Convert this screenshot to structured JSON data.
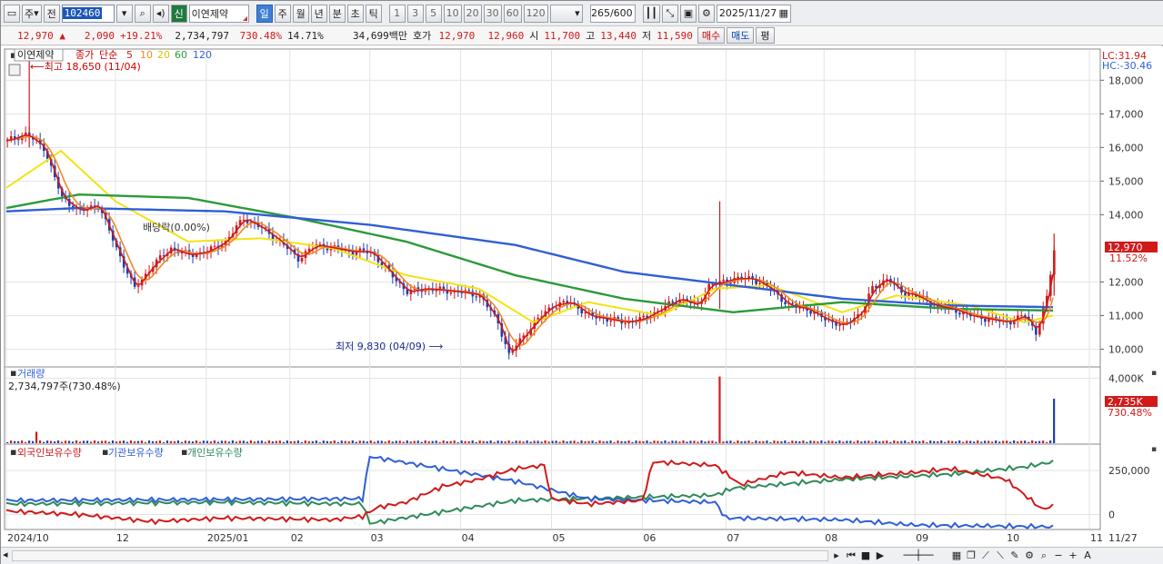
{
  "toolbar": {
    "period": "주",
    "prev_label": "전",
    "stock_code": "102460",
    "shin_label": "신",
    "stock_name": "이연제약",
    "tabs": [
      "일",
      "주",
      "월",
      "년",
      "분",
      "초",
      "틱"
    ],
    "active_tab": 0,
    "minute_options": [
      "1",
      "3",
      "5",
      "10",
      "20",
      "30",
      "60",
      "120"
    ],
    "bar_count": "265",
    "bar_max": "/600",
    "date": "2025/11/27"
  },
  "quote": {
    "price": "12,970",
    "arrow": "▲",
    "change": "2,090",
    "change_pct": "+19.21%",
    "volume": "2,734,797",
    "volume_ratio": "730.48%",
    "turnover": "14.71%",
    "amount": "34,699백만",
    "bid_label": "호가",
    "ask_price": "12,970",
    "bid_price": "12,960",
    "open_label": "시",
    "open": "11,700",
    "high_label": "고",
    "high": "13,440",
    "low_label": "저",
    "low": "11,590",
    "buy_label": "매수",
    "sell_label": "매도",
    "avg_label": "평"
  },
  "colors": {
    "up": "#d11a1a",
    "down": "#1f3fb0",
    "ma5": "#d11a1a",
    "ma10": "#f08a24",
    "ma20": "#f2e312",
    "ma60": "#2b9a3a",
    "ma120": "#2f5fd6",
    "foreign": "#d11a1a",
    "institution": "#2f5fd6",
    "individual": "#2e8b57"
  },
  "chart_data": [
    {
      "type": "candlestick",
      "legend": {
        "name": "이연제약",
        "price_label": "종가",
        "ma_label": "단순",
        "ma_periods": [
          "5",
          "10",
          "20",
          "60",
          "120"
        ]
      },
      "y_ticks": [
        "18,000",
        "17,000",
        "16,000",
        "15,000",
        "14,000",
        "12,000",
        "11,000",
        "10,000"
      ],
      "ylim": [
        9500,
        18900
      ],
      "right_labels": {
        "lc": "LC:31.94",
        "hc": "HC:-30.46",
        "current_price": "12,970",
        "current_pct": "11.52%"
      },
      "annotations": {
        "high": "최고 18,650 (11/04)",
        "low": "최저 9,830 (04/09)",
        "dividend": "배당락(0.00%)"
      },
      "price_path": [
        [
          0,
          16200
        ],
        [
          5,
          16400
        ],
        [
          10,
          16000
        ],
        [
          15,
          14500
        ],
        [
          20,
          14100
        ],
        [
          25,
          14300
        ],
        [
          30,
          13000
        ],
        [
          35,
          11800
        ],
        [
          40,
          12500
        ],
        [
          45,
          13000
        ],
        [
          50,
          12800
        ],
        [
          55,
          12900
        ],
        [
          60,
          13200
        ],
        [
          65,
          13900
        ],
        [
          70,
          13600
        ],
        [
          75,
          13200
        ],
        [
          80,
          12700
        ],
        [
          85,
          13100
        ],
        [
          90,
          13000
        ],
        [
          95,
          12900
        ],
        [
          100,
          12900
        ],
        [
          105,
          12300
        ],
        [
          110,
          11700
        ],
        [
          115,
          11800
        ],
        [
          120,
          11750
        ],
        [
          125,
          11700
        ],
        [
          130,
          11600
        ],
        [
          135,
          10800
        ],
        [
          138,
          9830
        ],
        [
          142,
          10400
        ],
        [
          146,
          10900
        ],
        [
          150,
          11300
        ],
        [
          155,
          11400
        ],
        [
          160,
          11000
        ],
        [
          165,
          10900
        ],
        [
          170,
          10800
        ],
        [
          175,
          10900
        ],
        [
          180,
          11200
        ],
        [
          185,
          11500
        ],
        [
          190,
          11300
        ],
        [
          193,
          11900
        ],
        [
          197,
          12000
        ],
        [
          200,
          12100
        ],
        [
          205,
          12100
        ],
        [
          210,
          11800
        ],
        [
          215,
          11300
        ],
        [
          220,
          11200
        ],
        [
          225,
          10900
        ],
        [
          230,
          10700
        ],
        [
          235,
          11100
        ],
        [
          238,
          11800
        ],
        [
          242,
          12100
        ],
        [
          246,
          11700
        ],
        [
          250,
          11600
        ],
        [
          255,
          11300
        ],
        [
          260,
          11200
        ],
        [
          265,
          11000
        ],
        [
          270,
          10900
        ],
        [
          275,
          10800
        ],
        [
          280,
          11000
        ],
        [
          283,
          10500
        ],
        [
          286,
          11500
        ],
        [
          288,
          12970
        ]
      ],
      "ma120_path": [
        [
          0,
          14100
        ],
        [
          20,
          14200
        ],
        [
          60,
          14100
        ],
        [
          100,
          13700
        ],
        [
          140,
          13100
        ],
        [
          170,
          12300
        ],
        [
          200,
          11900
        ],
        [
          230,
          11500
        ],
        [
          260,
          11300
        ],
        [
          288,
          11250
        ]
      ],
      "ma60_path": [
        [
          0,
          14200
        ],
        [
          20,
          14600
        ],
        [
          50,
          14500
        ],
        [
          80,
          13900
        ],
        [
          110,
          13200
        ],
        [
          140,
          12200
        ],
        [
          170,
          11500
        ],
        [
          200,
          11100
        ],
        [
          230,
          11400
        ],
        [
          260,
          11200
        ],
        [
          288,
          11150
        ]
      ],
      "ma20_path": [
        [
          0,
          14800
        ],
        [
          15,
          15900
        ],
        [
          30,
          14400
        ],
        [
          50,
          13200
        ],
        [
          70,
          13300
        ],
        [
          90,
          13000
        ],
        [
          110,
          12200
        ],
        [
          130,
          11800
        ],
        [
          145,
          10800
        ],
        [
          160,
          11400
        ],
        [
          180,
          11000
        ],
        [
          195,
          11800
        ],
        [
          210,
          11900
        ],
        [
          230,
          11100
        ],
        [
          245,
          11600
        ],
        [
          265,
          11300
        ],
        [
          280,
          10800
        ],
        [
          288,
          11000
        ]
      ]
    },
    {
      "type": "bar",
      "title": "거래량",
      "value_label": "2,734,797주(730.48%)",
      "y_ticks": [
        "4,000K"
      ],
      "ylim": [
        0,
        4300
      ],
      "current_label": "2,735K",
      "current_pct": "730.48%",
      "spikes": [
        [
          8,
          700
        ],
        [
          196,
          4100
        ],
        [
          288,
          2735
        ]
      ]
    },
    {
      "type": "line",
      "series_names": [
        "외국인보유수량",
        "기관보유수량",
        "개인보유수량"
      ],
      "y_ticks": [
        "250,000",
        "0"
      ],
      "ylim": [
        -80000,
        380000
      ],
      "foreign_path": [
        [
          0,
          20000
        ],
        [
          20,
          0
        ],
        [
          40,
          -40000
        ],
        [
          60,
          -20000
        ],
        [
          90,
          -30000
        ],
        [
          98,
          -10000
        ],
        [
          102,
          40000
        ],
        [
          110,
          70000
        ],
        [
          120,
          160000
        ],
        [
          130,
          200000
        ],
        [
          140,
          260000
        ],
        [
          148,
          280000
        ],
        [
          150,
          90000
        ],
        [
          160,
          60000
        ],
        [
          175,
          80000
        ],
        [
          178,
          300000
        ],
        [
          195,
          280000
        ],
        [
          202,
          170000
        ],
        [
          215,
          240000
        ],
        [
          230,
          210000
        ],
        [
          250,
          240000
        ],
        [
          260,
          260000
        ],
        [
          275,
          200000
        ],
        [
          285,
          30000
        ],
        [
          288,
          50000
        ]
      ],
      "institution_path": [
        [
          0,
          80000
        ],
        [
          98,
          90000
        ],
        [
          100,
          330000
        ],
        [
          140,
          190000
        ],
        [
          160,
          90000
        ],
        [
          195,
          70000
        ],
        [
          198,
          -20000
        ],
        [
          230,
          -30000
        ],
        [
          250,
          -60000
        ],
        [
          288,
          -70000
        ]
      ],
      "individual_path": [
        [
          0,
          60000
        ],
        [
          60,
          70000
        ],
        [
          98,
          60000
        ],
        [
          100,
          -50000
        ],
        [
          140,
          80000
        ],
        [
          195,
          110000
        ],
        [
          200,
          150000
        ],
        [
          230,
          200000
        ],
        [
          260,
          230000
        ],
        [
          280,
          270000
        ],
        [
          288,
          300000
        ]
      ]
    }
  ],
  "x_axis": {
    "labels": [
      "2024/10",
      "12",
      "2025/01",
      "02",
      "03",
      "04",
      "05",
      "06",
      "07",
      "08",
      "09",
      "10",
      "11"
    ],
    "label_index": [
      0,
      30,
      55,
      78,
      100,
      125,
      150,
      175,
      198,
      225,
      250,
      275,
      298
    ],
    "last_label": "11/27"
  }
}
